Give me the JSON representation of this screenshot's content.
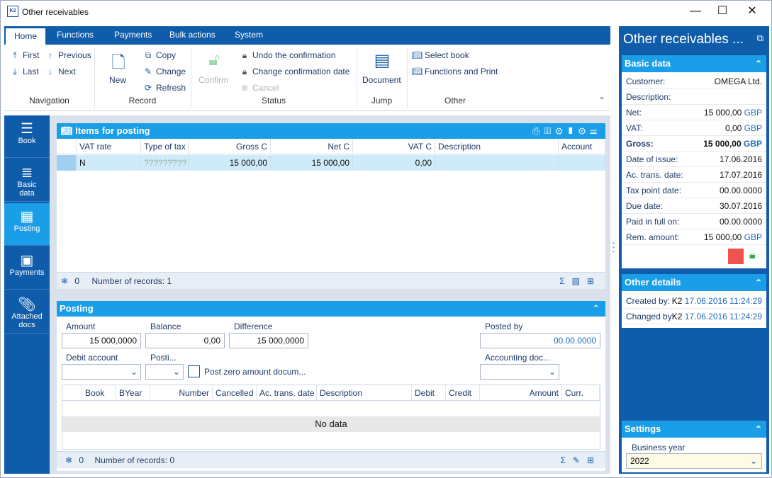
{
  "window": {
    "title": "Other receivables",
    "logo": "K2",
    "minimize": "—",
    "maximize": "☐",
    "close": "✕"
  },
  "ribbon": {
    "tabs": [
      "Home",
      "Functions",
      "Payments",
      "Bulk actions",
      "System"
    ],
    "navigation": {
      "first": "First",
      "previous": "Previous",
      "last": "Last",
      "next": "Next",
      "group": "Navigation"
    },
    "record": {
      "new": "New",
      "copy": "Copy",
      "change": "Change",
      "refresh": "Refresh",
      "group": "Record"
    },
    "status": {
      "confirm": "Confirm",
      "undo": "Undo the confirmation",
      "change_date": "Change confirmation date",
      "cancel": "Cancel",
      "group": "Status"
    },
    "jump": {
      "document": "Document",
      "group": "Jump"
    },
    "other": {
      "select_book": "Select book",
      "functions_print": "Functions and Print",
      "group": "Other"
    }
  },
  "sidenav": [
    {
      "label": "Book",
      "icon": "menu-icon"
    },
    {
      "label": "Basic data",
      "icon": "list-icon"
    },
    {
      "label": "Posting",
      "icon": "calculator-icon"
    },
    {
      "label": "Payments",
      "icon": "inbox-icon"
    },
    {
      "label": "Attached docs",
      "icon": "paperclip-icon"
    }
  ],
  "items_panel": {
    "title": "Items for posting",
    "columns": [
      "VAT rate",
      "Type of tax",
      "Gross C",
      "Net C",
      "VAT C",
      "Description",
      "Account"
    ],
    "rows": [
      {
        "vat_rate": "N",
        "type_of_tax": "?????????",
        "gross": "15 000,00",
        "net": "15 000,00",
        "vat": "0,00",
        "description": "",
        "account": ""
      }
    ],
    "footer": {
      "count": "0",
      "records": "Number of records: 1"
    }
  },
  "posting": {
    "title": "Posting",
    "amount_label": "Amount",
    "amount": "15 000,0000",
    "balance_label": "Balance",
    "balance": "0,00",
    "difference_label": "Difference",
    "difference": "15 000,0000",
    "posted_by_label": "Posted by",
    "posted_by": "00.00.0000",
    "debit_account_label": "Debit account",
    "posti_label": "Posti...",
    "zero_label": "Post zero amount docum...",
    "accounting_doc_label": "Accounting doc...",
    "columns": [
      "Book",
      "BYear",
      "Number",
      "Cancelled",
      "Ac. trans. date",
      "Description",
      "Debit",
      "Credit",
      "Amount",
      "Curr."
    ],
    "no_data": "No data",
    "footer": {
      "count": "0",
      "records": "Number of records: 0"
    }
  },
  "right_panel": {
    "title": "Other receivables ...",
    "basic_title": "Basic data",
    "basic": [
      {
        "k": "Customer:",
        "v": "OMEGA Ltd."
      },
      {
        "k": "Description:",
        "v": ""
      },
      {
        "k": "Net:",
        "v": "15 000,00",
        "c": "GBP"
      },
      {
        "k": "VAT:",
        "v": "0,00",
        "c": "GBP"
      },
      {
        "k": "Gross:",
        "v": "15 000,00",
        "c": "GBP"
      },
      {
        "k": "Date of issue:",
        "v": "17.06.2016"
      },
      {
        "k": "Ac. trans. date:",
        "v": "17.07.2016"
      },
      {
        "k": "Tax point date:",
        "v": "00.00.0000"
      },
      {
        "k": "Due date:",
        "v": "30.07.2016"
      },
      {
        "k": "Paid in full on:",
        "v": "00.00.0000"
      },
      {
        "k": "Rem. amount:",
        "v": "15 000,00",
        "c": "GBP"
      }
    ],
    "other_title": "Other details",
    "created_label": "Created by:",
    "created_user": "K2",
    "created_date": "17.06.2016 11:24:29",
    "changed_label": "Changed by:",
    "changed_user": "K2",
    "changed_date": "17.06.2016 11:24:29",
    "settings_title": "Settings",
    "business_year_label": "Business year",
    "business_year": "2022"
  },
  "colors": {
    "accent": "#1b9ee8",
    "nav": "#0f5cab",
    "status_red": "#ef5350",
    "lock_green": "#2ea84a"
  }
}
